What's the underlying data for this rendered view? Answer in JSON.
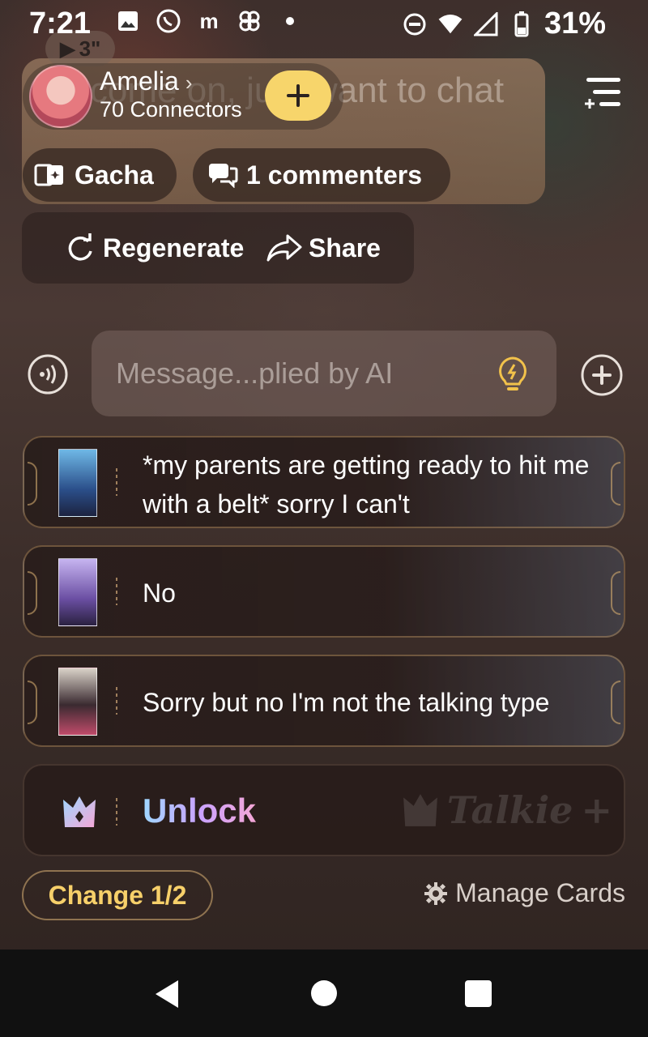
{
  "status_bar": {
    "time": "7:21",
    "battery": "31%",
    "notification_icons": [
      "image-icon",
      "whatsapp-icon",
      "mzone-icon",
      "pinwheel-icon",
      "dot-icon"
    ],
    "system_icons": [
      "dnd-icon",
      "data-arrows-icon",
      "wifi-icon",
      "signal-icon",
      "battery-icon"
    ]
  },
  "video_chip": {
    "label": "3\""
  },
  "header": {
    "character_name": "Amelia",
    "connectors": "70 Connectors",
    "ghost_message": "n, come on, just want to chat",
    "gacha_label": "Gacha",
    "commenters_label": "1 commenters"
  },
  "actions": {
    "regenerate_label": "Regenerate",
    "share_label": "Share"
  },
  "composer": {
    "placeholder": "Message...plied by AI"
  },
  "reply_cards": [
    {
      "text": "*my parents are getting ready to hit me with a belt* sorry I can't"
    },
    {
      "text": "No"
    },
    {
      "text": "Sorry but no I'm not the talking type"
    }
  ],
  "unlock": {
    "label": "Unlock",
    "brand": "Talkie",
    "brand_suffix": "+"
  },
  "footer": {
    "change_label": "Change 1/2",
    "manage_cards_label": "Manage Cards"
  },
  "colors": {
    "accent_yellow": "#f7d56b",
    "change_text": "#f7d06a",
    "unlock_gradient": [
      "#9fd7ff",
      "#c9a3ff",
      "#f4a6d6"
    ]
  }
}
